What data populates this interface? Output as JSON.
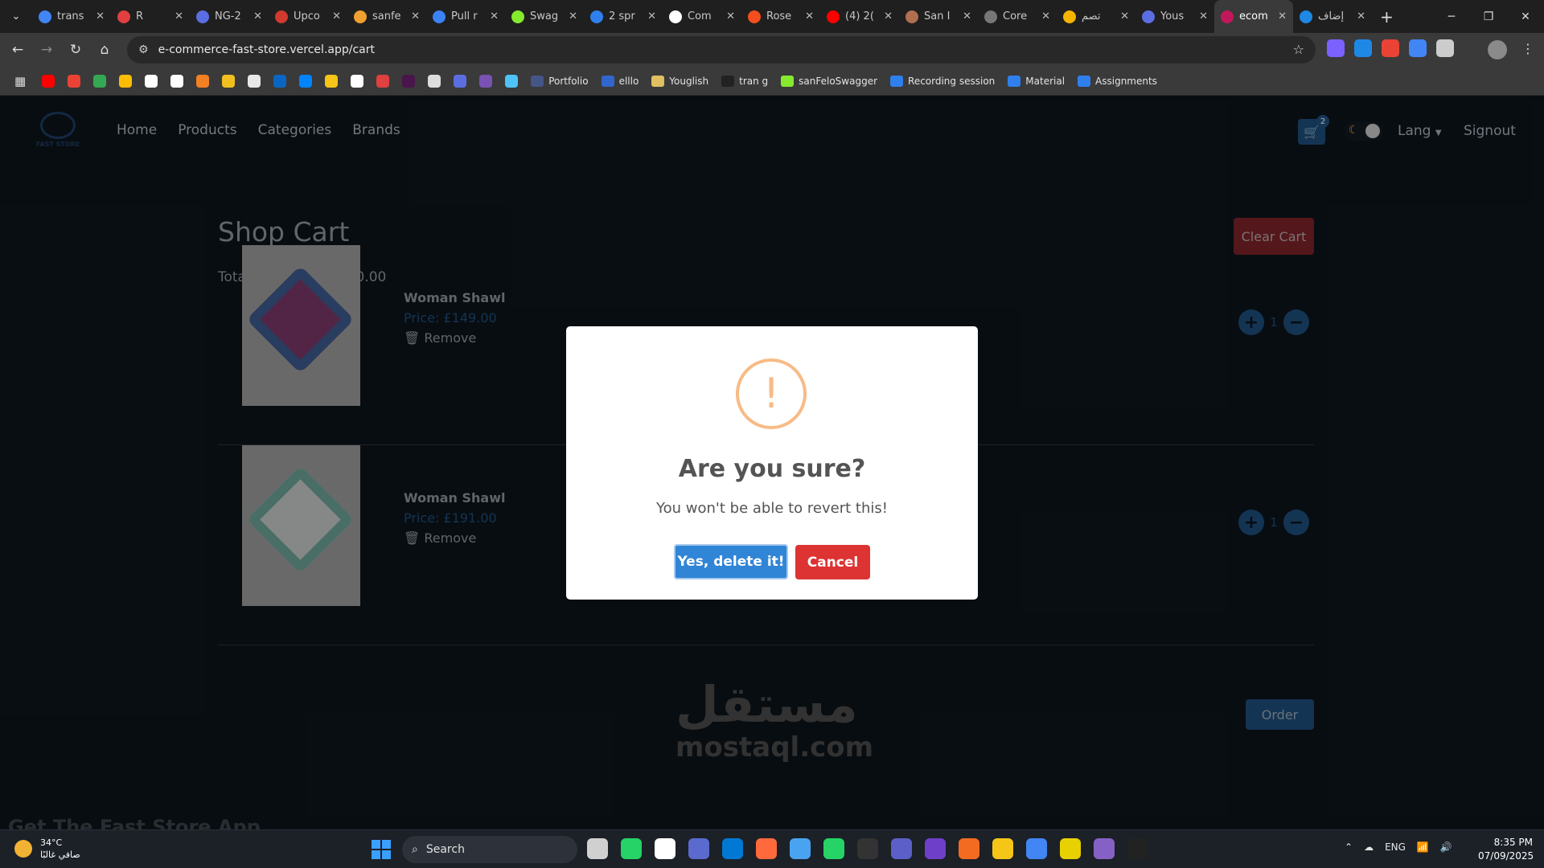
{
  "browser": {
    "tabs": [
      {
        "title": "trans",
        "color": "#4285f4"
      },
      {
        "title": "R",
        "color": "#e04040"
      },
      {
        "title": "NG-2",
        "color": "#5b6ee1"
      },
      {
        "title": "Upco",
        "color": "#d03a2f"
      },
      {
        "title": "sanfe",
        "color": "#f0a030"
      },
      {
        "title": "Pull r",
        "color": "#3b82f6"
      },
      {
        "title": "Swag",
        "color": "#85ea2d"
      },
      {
        "title": "2 spr",
        "color": "#2f80ed"
      },
      {
        "title": "Com",
        "color": "#ffffff"
      },
      {
        "title": "Rose",
        "color": "#f24e1e"
      },
      {
        "title": "(4) 2(",
        "color": "#ff0000"
      },
      {
        "title": "San I",
        "color": "#b07050"
      },
      {
        "title": "Core",
        "color": "#777777"
      },
      {
        "title": "تصم",
        "color": "#f5b400"
      },
      {
        "title": "Yous",
        "color": "#5b6ee1"
      },
      {
        "title": "ecom",
        "color": "#c2185b"
      },
      {
        "title": "إضاف",
        "color": "#1e88e5"
      }
    ],
    "active_tab_index": 15,
    "url": "e-commerce-fast-store.vercel.app/cart",
    "bookmarks": [
      {
        "label": "Portfolio",
        "color": "#445588"
      },
      {
        "label": "elllo",
        "color": "#3366cc"
      },
      {
        "label": "Youglish",
        "color": "#e0c060"
      },
      {
        "label": "tran g",
        "color": "#222222"
      },
      {
        "label": "sanFeloSwagger",
        "color": "#85ea2d"
      },
      {
        "label": "Recording session",
        "color": "#2f80ed"
      },
      {
        "label": "Material",
        "color": "#2f80ed"
      },
      {
        "label": "Assignments",
        "color": "#2f80ed"
      }
    ],
    "bookmark_icons": [
      "#ff0000",
      "#ea4335",
      "#34a853",
      "#fbbc04",
      "#ffffff",
      "#ffffff",
      "#f48024",
      "#f0c020",
      "#e8e8e8",
      "#0a66c2",
      "#0084ff",
      "#f5c518",
      "#ffffff",
      "#e04040",
      "#4a154b",
      "#dddddd",
      "#5b6ee1",
      "#7952b3",
      "#4fc3f7"
    ],
    "extension_colors": [
      "#7b61ff",
      "#1e88e5",
      "#ea4335",
      "#4285f4",
      "#cccccc"
    ]
  },
  "site": {
    "logo_text": "FAST STORE",
    "nav": [
      "Home",
      "Products",
      "Categories",
      "Brands"
    ],
    "cart_count": "2",
    "lang_label": "Lang",
    "signout_label": "Signout"
  },
  "cart": {
    "title": "Shop Cart",
    "clear_label": "Clear Cart",
    "total_label": "Total Cart Price: £340.00",
    "items": [
      {
        "name": "Woman Shawl",
        "price": "Price: £149.00",
        "remove_label": "Remove",
        "qty": "1",
        "variant": "a"
      },
      {
        "name": "Woman Shawl",
        "price": "Price: £191.00",
        "remove_label": "Remove",
        "qty": "1",
        "variant": "b"
      }
    ],
    "order_label": "Order",
    "app_promo": "Get The Fast Store App"
  },
  "watermark": {
    "arabic": "مستقل",
    "latin": "mostaql.com"
  },
  "modal": {
    "icon_glyph": "!",
    "title": "Are you sure?",
    "text": "You won't be able to revert this!",
    "confirm_label": "Yes, delete it!",
    "cancel_label": "Cancel"
  },
  "taskbar": {
    "temp": "34°C",
    "condition": "صافي غالبًا",
    "search_label": "Search",
    "app_colors": [
      "#d0d0d0",
      "#25d366",
      "#ffffff",
      "#5a6acf",
      "#0078d4",
      "#ff6a3d",
      "#4aa3f0",
      "#25d366",
      "#333333",
      "#5b5fc7",
      "#6e40c9",
      "#f26b21",
      "#f5c518",
      "#4285f4",
      "#e8d100",
      "#8661c5",
      "#222222"
    ],
    "lang": "ENG",
    "time": "8:35 PM",
    "date": "07/09/2025"
  }
}
